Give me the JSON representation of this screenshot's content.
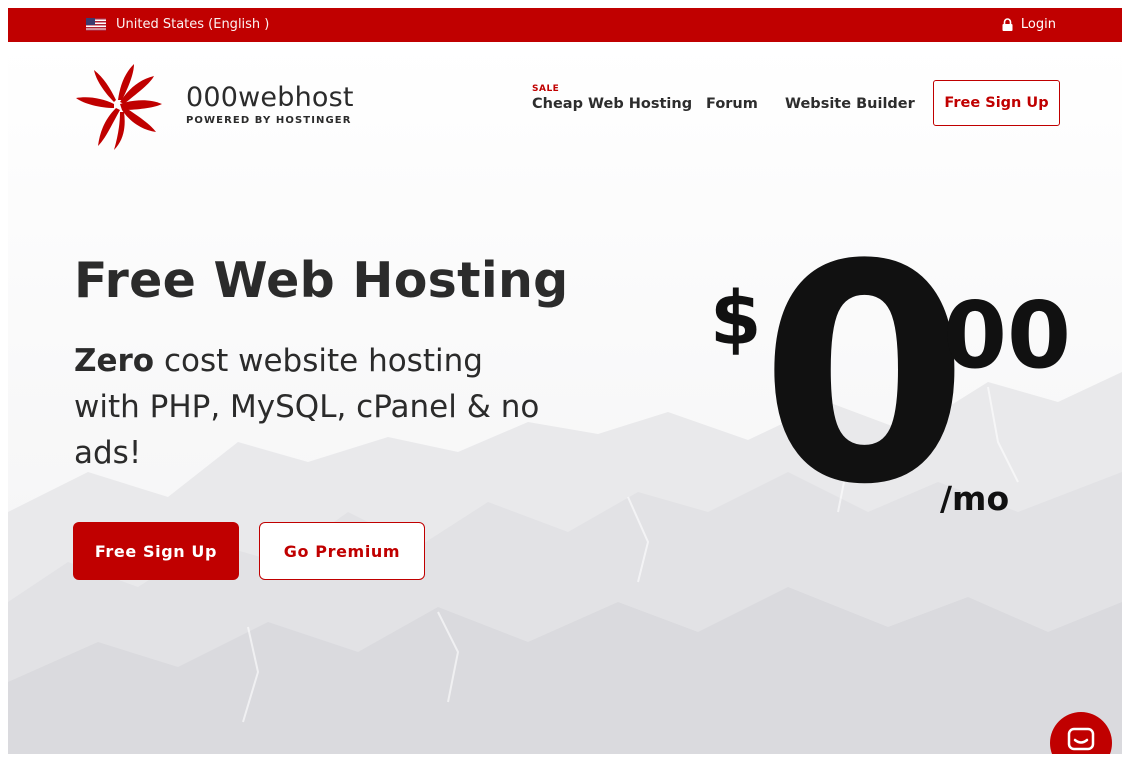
{
  "topbar": {
    "locale_label": "United States (English )",
    "login_label": "Login"
  },
  "header": {
    "logo_name": "000webhost",
    "logo_sub": "POWERED BY HOSTINGER",
    "nav": {
      "sale_tag": "SALE",
      "cheap_hosting": "Cheap Web Hosting",
      "forum": "Forum",
      "website_builder": "Website Builder",
      "signup": "Free Sign Up"
    }
  },
  "hero": {
    "title": "Free Web Hosting",
    "subtitle_bold": "Zero",
    "subtitle_rest": " cost website hosting with PHP, MySQL, cPanel & no ads!",
    "primary_button": "Free Sign Up",
    "secondary_button": "Go Premium"
  },
  "price": {
    "currency": "$",
    "integer": "0",
    "decimal": "00",
    "period": "/mo"
  },
  "colors": {
    "brand_red": "#c00000",
    "text_dark": "#2b2b2b"
  },
  "icons": [
    "us-flag-icon",
    "lock-icon",
    "swirl-logo-icon",
    "chat-icon"
  ]
}
